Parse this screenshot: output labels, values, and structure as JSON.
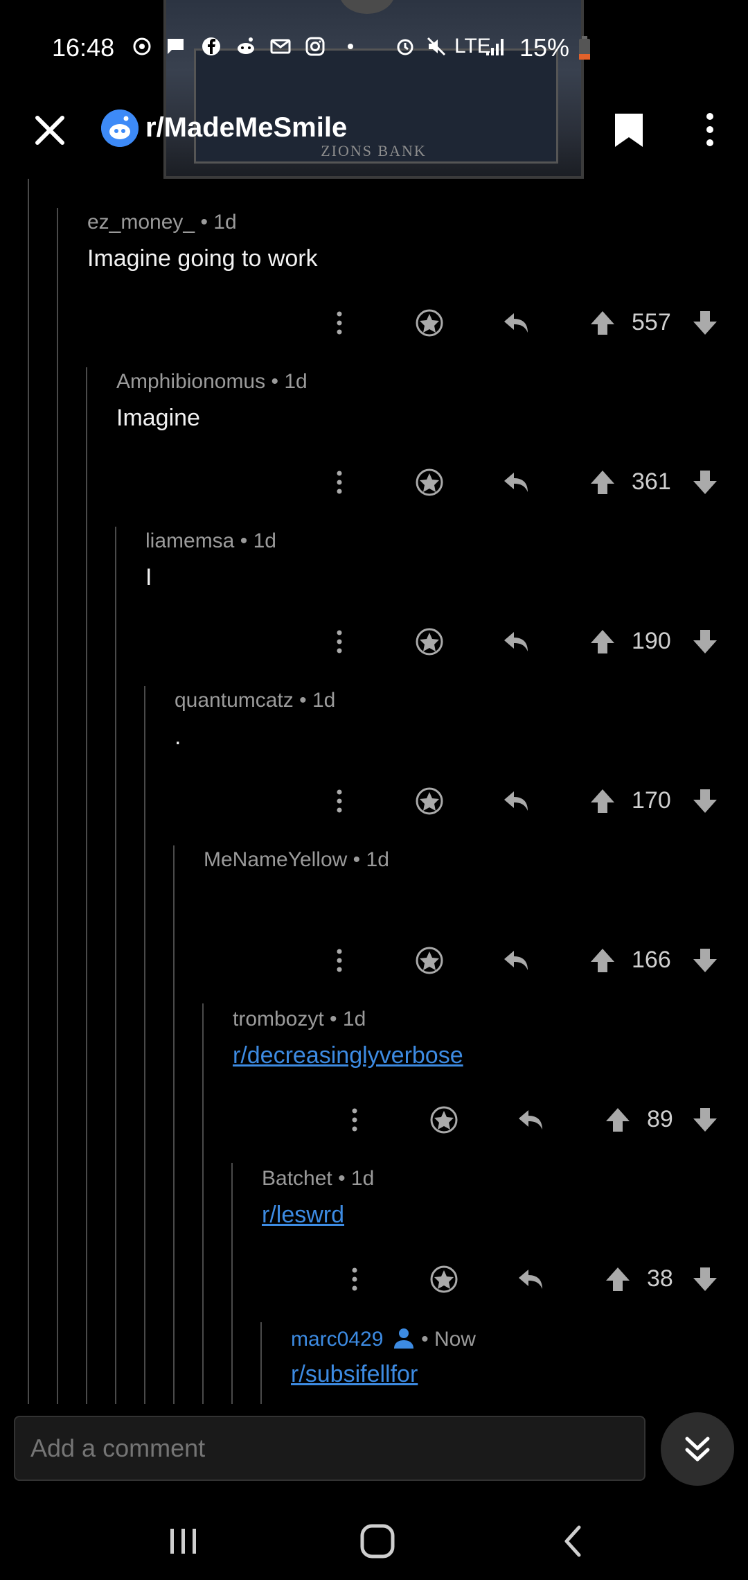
{
  "status_bar": {
    "time": "16:48",
    "network": "LTE",
    "battery": "15%",
    "battery_color": "#e2622b"
  },
  "header": {
    "subreddit": "r/MadeMeSmile"
  },
  "video": {
    "banner_text": "ZIONS BANK"
  },
  "comments": [
    {
      "author": "ez_money_",
      "time": "1d",
      "body": "Imagine going to work",
      "votes": "557",
      "is_link": false
    },
    {
      "author": "Amphibionomus",
      "time": "1d",
      "body": "Imagine",
      "votes": "361",
      "is_link": false
    },
    {
      "author": "liamemsa",
      "time": "1d",
      "body": "I",
      "votes": "190",
      "is_link": false
    },
    {
      "author": "quantumcatz",
      "time": "1d",
      "body": ".",
      "votes": "170",
      "is_link": false
    },
    {
      "author": "MeNameYellow",
      "time": "1d",
      "body": "",
      "votes": "166",
      "is_link": false
    },
    {
      "author": "trombozyt",
      "time": "1d",
      "body": "r/decreasinglyverbose",
      "votes": "89",
      "is_link": true
    },
    {
      "author": "Batchet",
      "time": "1d",
      "body": "r/leswrd",
      "votes": "38",
      "is_link": true
    },
    {
      "author": "marc0429",
      "time": "Now",
      "body": "r/subsifellfor",
      "is_link": true,
      "is_self": true
    }
  ],
  "composer": {
    "placeholder": "Add a comment"
  },
  "colors": {
    "link": "#3d8be2",
    "meta": "#9b9b9b",
    "thread_line": "#4a4a4a"
  }
}
